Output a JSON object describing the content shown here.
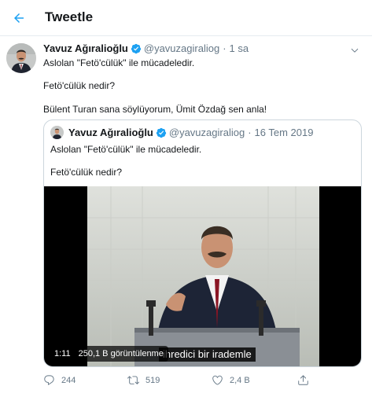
{
  "header": {
    "title": "Tweetle"
  },
  "tweet": {
    "author": {
      "name": "Yavuz Ağıralioğlu",
      "handle": "@yavuzagiraliog"
    },
    "separator": "·",
    "time": "1 sa",
    "lines": [
      "Aslolan \"Fetö'cülük\" ile mücadeledir.",
      "Fetö'cülük nedir?",
      "Bülent Turan sana söylüyorum, Ümit Özdağ sen anla!"
    ],
    "quoted": {
      "author": {
        "name": "Yavuz Ağıralioğlu",
        "handle": "@yavuzagiraliog"
      },
      "date": "16 Tem 2019",
      "lines": [
        "Aslolan \"Fetö'cülük\" ile mücadeledir.",
        "Fetö'cülük nedir?"
      ],
      "video": {
        "duration": "1:11",
        "views": "250,1 B görüntülenme",
        "subtitle": "ihredici bir irademle"
      }
    },
    "actions": {
      "replies": "244",
      "retweets": "519",
      "likes": "2,4 B",
      "share": ""
    }
  },
  "colors": {
    "accent": "#1da1f2",
    "secondary_text": "#657786",
    "border": "#e6ecf0",
    "verified": "#1da1f2"
  },
  "icons": [
    "back-arrow-icon",
    "verified-icon",
    "caret-down-icon",
    "reply-icon",
    "retweet-icon",
    "like-icon",
    "share-icon"
  ]
}
